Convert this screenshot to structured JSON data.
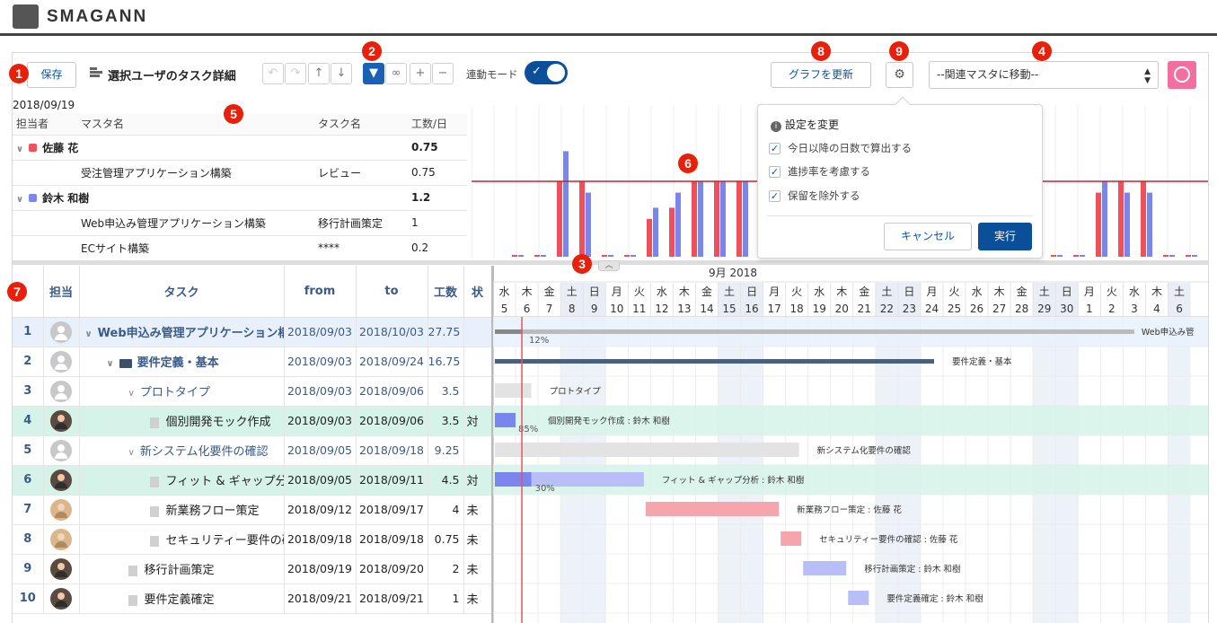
{
  "app": {
    "brand": "SMAGANN"
  },
  "markers": [
    "1",
    "2",
    "3",
    "4",
    "5",
    "6",
    "7",
    "8",
    "9"
  ],
  "toolbar": {
    "save_label": "保存",
    "view_title": "選択ユーザのタスク詳細",
    "link_mode_label": "連動モード",
    "update_graph_label": "グラフを更新",
    "related_master_select": "--関連マスタに移動--"
  },
  "summary": {
    "date": "2018/09/19",
    "columns": [
      "担当者",
      "マスタ名",
      "タスク名",
      "工数/日"
    ],
    "groups": [
      {
        "name": "佐藤 花",
        "color": "#f04f5b",
        "total": "0.75",
        "rows": [
          {
            "master": "受注管理アプリケーション構築",
            "task": "レビュー",
            "work": "0.75"
          }
        ]
      },
      {
        "name": "鈴木 和樹",
        "color": "#7b85ee",
        "total": "1.2",
        "rows": [
          {
            "master": "Web申込み管理アプリケーション構築",
            "task": "移行計画策定",
            "work": "1"
          },
          {
            "master": "ECサイト構築",
            "task": "****",
            "work": "0.2"
          }
        ]
      }
    ]
  },
  "chart_data": {
    "type": "bar",
    "threshold": 1,
    "ylim": [
      0,
      1.7
    ],
    "series": [
      {
        "color": "#f04f5b",
        "values": [
          0,
          0,
          0,
          0,
          0,
          0,
          0,
          0,
          0,
          0,
          0,
          0,
          0,
          0,
          0,
          0,
          0,
          0,
          0,
          0,
          0,
          0,
          0,
          0,
          0,
          0,
          0,
          0,
          0,
          0,
          0,
          0,
          0,
          0,
          0,
          0,
          0,
          0,
          0,
          0,
          0,
          0,
          0,
          0,
          0,
          0,
          0,
          0,
          0,
          0,
          0,
          0,
          0,
          0,
          0,
          0,
          0,
          0,
          0,
          0,
          0,
          0,
          0
        ]
      },
      {
        "color": "#7b85ee",
        "values": [
          0,
          0,
          0,
          0,
          0,
          0,
          0,
          0,
          0,
          0,
          0,
          0,
          0,
          0,
          0,
          0,
          0,
          0,
          0,
          0,
          0,
          0,
          0,
          0,
          0,
          0,
          0,
          0,
          0,
          0,
          0,
          0,
          0,
          0,
          0,
          0,
          0,
          0,
          0,
          0,
          0,
          0,
          0,
          0,
          0,
          0,
          0,
          0,
          0,
          0,
          0,
          0,
          0,
          0,
          0,
          0,
          0,
          0,
          0,
          0,
          0,
          0,
          0
        ]
      }
    ],
    "pairs": [
      [
        0.02,
        0.02
      ],
      [
        0.02,
        0.02
      ],
      [
        1,
        1.4
      ],
      [
        1,
        0.85
      ],
      [
        0.02,
        0.02
      ],
      [
        0.02,
        0.02
      ],
      [
        0.5,
        0.65
      ],
      [
        0.65,
        0.85
      ],
      [
        1,
        1
      ],
      [
        1,
        1
      ],
      [
        1,
        1
      ],
      [
        0.02,
        0.02
      ],
      [
        0.02,
        0.02
      ],
      [
        0.02,
        0.02
      ],
      [
        0.02,
        0.02
      ],
      [
        0.02,
        0.02
      ],
      [
        0.02,
        0.02
      ],
      [
        0.02,
        0.02
      ],
      [
        0.02,
        0.02
      ],
      [
        0.02,
        0.02
      ],
      [
        0.02,
        0.02
      ],
      [
        0.02,
        0.02
      ],
      [
        0.02,
        0.02
      ],
      [
        0.02,
        0.02
      ],
      [
        0.02,
        0.02
      ],
      [
        0.02,
        0.02
      ],
      [
        0.85,
        1
      ],
      [
        1,
        0.85
      ],
      [
        1,
        0.85
      ],
      [
        0.02,
        0.02
      ],
      [
        0.02,
        0.02
      ],
      [
        0.02,
        0.02
      ]
    ]
  },
  "settings_popover": {
    "title": "設定を変更",
    "options": [
      {
        "label": "今日以降の日数で算出する",
        "checked": true
      },
      {
        "label": "進捗率を考慮する",
        "checked": true
      },
      {
        "label": "保留を除外する",
        "checked": true
      }
    ],
    "cancel_label": "キャンセル",
    "run_label": "実行"
  },
  "grid": {
    "columns": [
      "担当",
      "タスク",
      "from",
      "to",
      "工数",
      "状"
    ],
    "rows": [
      {
        "no": "1",
        "avatar": "default",
        "indent": 0,
        "icon": "chevron",
        "task": "Web申込み管理アプリケーション構築",
        "from": "2018/09/03",
        "to": "2018/10/03",
        "work": "27.75",
        "status": "",
        "style": "hl-blue blue"
      },
      {
        "no": "2",
        "avatar": "default",
        "indent": 1,
        "icon": "folder",
        "task": "要件定義・基本",
        "from": "2018/09/03",
        "to": "2018/09/24",
        "work": "16.75",
        "status": "",
        "style": "blue bold"
      },
      {
        "no": "3",
        "avatar": "default",
        "indent": 2,
        "icon": "chevron",
        "task": "プロトタイプ",
        "from": "2018/09/03",
        "to": "2018/09/06",
        "work": "3.5",
        "status": "",
        "style": "blue"
      },
      {
        "no": "4",
        "avatar": "m",
        "indent": 3,
        "icon": "doc",
        "task": "個別開発モック作成",
        "from": "2018/09/03",
        "to": "2018/09/06",
        "work": "3.5",
        "status": "対",
        "style": "hl-green"
      },
      {
        "no": "5",
        "avatar": "default",
        "indent": 2,
        "icon": "chevron",
        "task": "新システム化要件の確認",
        "from": "2018/09/05",
        "to": "2018/09/18",
        "work": "9.25",
        "status": "",
        "style": "blue"
      },
      {
        "no": "6",
        "avatar": "m",
        "indent": 3,
        "icon": "doc",
        "task": "フィット & ギャップ分析",
        "from": "2018/09/05",
        "to": "2018/09/11",
        "work": "4.5",
        "status": "対",
        "style": "hl-green"
      },
      {
        "no": "7",
        "avatar": "f",
        "indent": 3,
        "icon": "doc",
        "task": "新業務フロー策定",
        "from": "2018/09/12",
        "to": "2018/09/17",
        "work": "4",
        "status": "未",
        "style": ""
      },
      {
        "no": "8",
        "avatar": "f",
        "indent": 3,
        "icon": "doc",
        "task": "セキュリティー要件の確認",
        "from": "2018/09/18",
        "to": "2018/09/18",
        "work": "0.75",
        "status": "未",
        "style": ""
      },
      {
        "no": "9",
        "avatar": "m",
        "indent": 2,
        "icon": "doc",
        "task": "移行計画策定",
        "from": "2018/09/19",
        "to": "2018/09/20",
        "work": "2",
        "status": "未",
        "style": ""
      },
      {
        "no": "10",
        "avatar": "m",
        "indent": 2,
        "icon": "doc",
        "task": "要件定義確定",
        "from": "2018/09/21",
        "to": "2018/09/21",
        "work": "1",
        "status": "未",
        "style": ""
      }
    ]
  },
  "gantt": {
    "month_label": "9月 2018",
    "days": [
      {
        "w": "水",
        "d": "5"
      },
      {
        "w": "木",
        "d": "6"
      },
      {
        "w": "金",
        "d": "7"
      },
      {
        "w": "土",
        "d": "8",
        "off": true
      },
      {
        "w": "日",
        "d": "9",
        "off": true
      },
      {
        "w": "月",
        "d": "10"
      },
      {
        "w": "火",
        "d": "11"
      },
      {
        "w": "水",
        "d": "12"
      },
      {
        "w": "木",
        "d": "13"
      },
      {
        "w": "金",
        "d": "14"
      },
      {
        "w": "土",
        "d": "15",
        "off": true
      },
      {
        "w": "日",
        "d": "16",
        "off": true
      },
      {
        "w": "月",
        "d": "17"
      },
      {
        "w": "火",
        "d": "18"
      },
      {
        "w": "水",
        "d": "19"
      },
      {
        "w": "木",
        "d": "20"
      },
      {
        "w": "金",
        "d": "21"
      },
      {
        "w": "土",
        "d": "22",
        "off": true
      },
      {
        "w": "日",
        "d": "23",
        "off": true
      },
      {
        "w": "月",
        "d": "24"
      },
      {
        "w": "火",
        "d": "25"
      },
      {
        "w": "水",
        "d": "26"
      },
      {
        "w": "木",
        "d": "27"
      },
      {
        "w": "金",
        "d": "28"
      },
      {
        "w": "土",
        "d": "29",
        "off": true
      },
      {
        "w": "日",
        "d": "30",
        "off": true
      },
      {
        "w": "月",
        "d": "1"
      },
      {
        "w": "火",
        "d": "2"
      },
      {
        "w": "水",
        "d": "3"
      },
      {
        "w": "木",
        "d": "4"
      },
      {
        "w": "土",
        "d": "6",
        "off": true
      }
    ],
    "today_index": 1,
    "bars": [
      {
        "row": 0,
        "start": 0,
        "end": 28.5,
        "color": "#bbbbbb",
        "progress": "12%",
        "label": "Web申込み管",
        "type": "summary"
      },
      {
        "row": 1,
        "start": 0,
        "end": 19.6,
        "color": "#4a5f80",
        "progress": "",
        "label": "要件定義・基本",
        "type": "group"
      },
      {
        "row": 2,
        "start": 0,
        "end": 1.7,
        "color": "#e3e3e3",
        "progress": "",
        "label": "プロトタイプ",
        "type": "task"
      },
      {
        "row": 3,
        "start": 0,
        "end": 1.0,
        "color": "#7b85ee",
        "progress": "85%",
        "label": "個別開発モック作成 : 鈴木 和樹",
        "type": "task"
      },
      {
        "row": 4,
        "start": 0,
        "end": 13.6,
        "color": "#e3e3e3",
        "progress": "",
        "label": "新システム化要件の確認",
        "type": "task"
      },
      {
        "row": 5,
        "start": 0,
        "end": 6.7,
        "color": "#b8bff7",
        "progress": "30%",
        "label": "フィット & ギャップ分析 : 鈴木 和樹",
        "type": "task",
        "done_to": 1.7
      },
      {
        "row": 6,
        "start": 6.7,
        "end": 12.7,
        "color": "#f7a5ac",
        "progress": "",
        "label": "新業務フロー策定 : 佐藤 花",
        "type": "task"
      },
      {
        "row": 7,
        "start": 12.7,
        "end": 13.7,
        "color": "#f7a5ac",
        "progress": "",
        "label": "セキュリティー要件の確認 : 佐藤 花",
        "type": "task"
      },
      {
        "row": 8,
        "start": 13.7,
        "end": 15.7,
        "color": "#b8bff7",
        "progress": "",
        "label": "移行計画策定 : 鈴木 和樹",
        "type": "task"
      },
      {
        "row": 9,
        "start": 15.7,
        "end": 16.7,
        "color": "#b8bff7",
        "progress": "",
        "label": "要件定義確定 : 鈴木 和樹",
        "type": "task"
      }
    ]
  }
}
